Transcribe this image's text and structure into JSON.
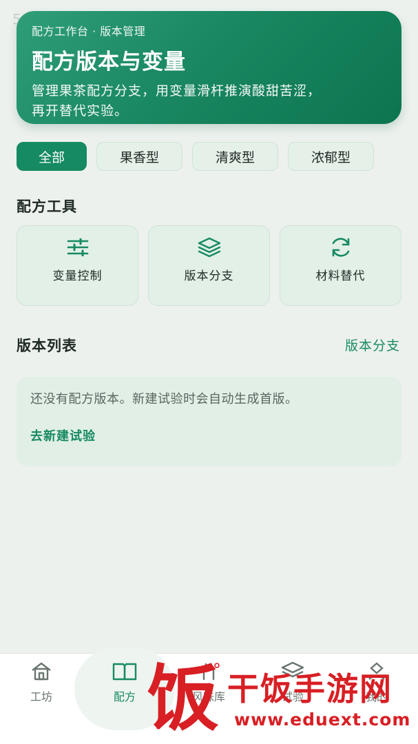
{
  "status": {
    "time_fragment": "5"
  },
  "header": {
    "breadcrumb": "配方工作台 · 版本管理",
    "title": "配方版本与变量",
    "description_line1": "管理果茶配方分支，用变量滑杆推演酸甜苦涩，",
    "description_line2": "再开替代实验。"
  },
  "filters": [
    {
      "label": "全部",
      "active": true
    },
    {
      "label": "果香型",
      "active": false
    },
    {
      "label": "清爽型",
      "active": false
    },
    {
      "label": "浓郁型",
      "active": false
    }
  ],
  "tools": {
    "title": "配方工具",
    "items": [
      {
        "label": "变量控制",
        "icon": "sliders-icon"
      },
      {
        "label": "版本分支",
        "icon": "layers-icon"
      },
      {
        "label": "材料替代",
        "icon": "refresh-icon"
      }
    ]
  },
  "versions": {
    "title": "版本列表",
    "link_label": "版本分支",
    "empty_text": "还没有配方版本。新建试验时会自动生成首版。",
    "empty_action": "去新建试验"
  },
  "tabs": [
    {
      "label": "工坊",
      "icon": "home-icon",
      "active": false
    },
    {
      "label": "配方",
      "icon": "book-icon",
      "active": true
    },
    {
      "label": "风味库",
      "icon": "flavor-icon",
      "active": false
    },
    {
      "label": "试验",
      "icon": "layers-icon",
      "active": false
    },
    {
      "label": "我的",
      "icon": "user-icon",
      "active": false
    }
  ],
  "watermark": {
    "logo_text": "饭",
    "brand": "干饭手游网",
    "url": "www.eduext.com"
  },
  "colors": {
    "accent": "#168a62",
    "hero_start": "#2f9e78",
    "hero_end": "#0c7550",
    "card_bg": "#e2f0e7",
    "watermark": "#d81f24"
  }
}
